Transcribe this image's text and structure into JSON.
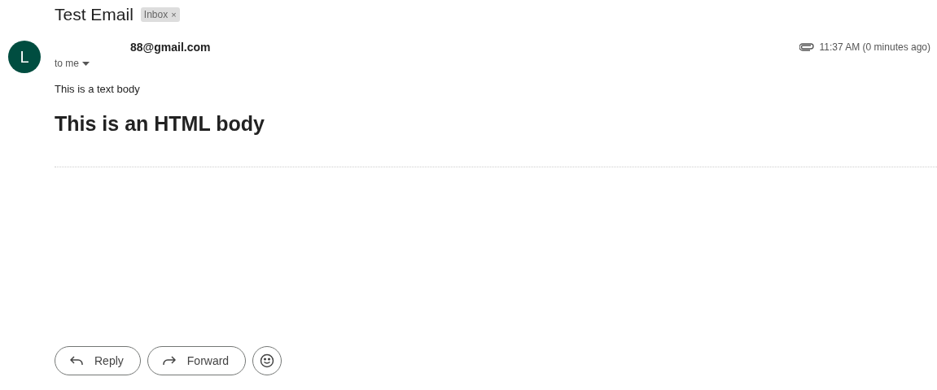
{
  "subject": "Test Email",
  "label": {
    "text": "Inbox",
    "close": "×"
  },
  "avatar": "L",
  "sender": "88@gmail.com",
  "recipient": "to me",
  "time": "11:37 AM (0 minutes ago)",
  "text_body": "This is a text body",
  "html_body": "This is an HTML body",
  "actions": [
    {
      "kind": "reply",
      "label": "Reply"
    },
    {
      "kind": "forward",
      "label": "Forward"
    },
    {
      "kind": "emoji"
    }
  ]
}
